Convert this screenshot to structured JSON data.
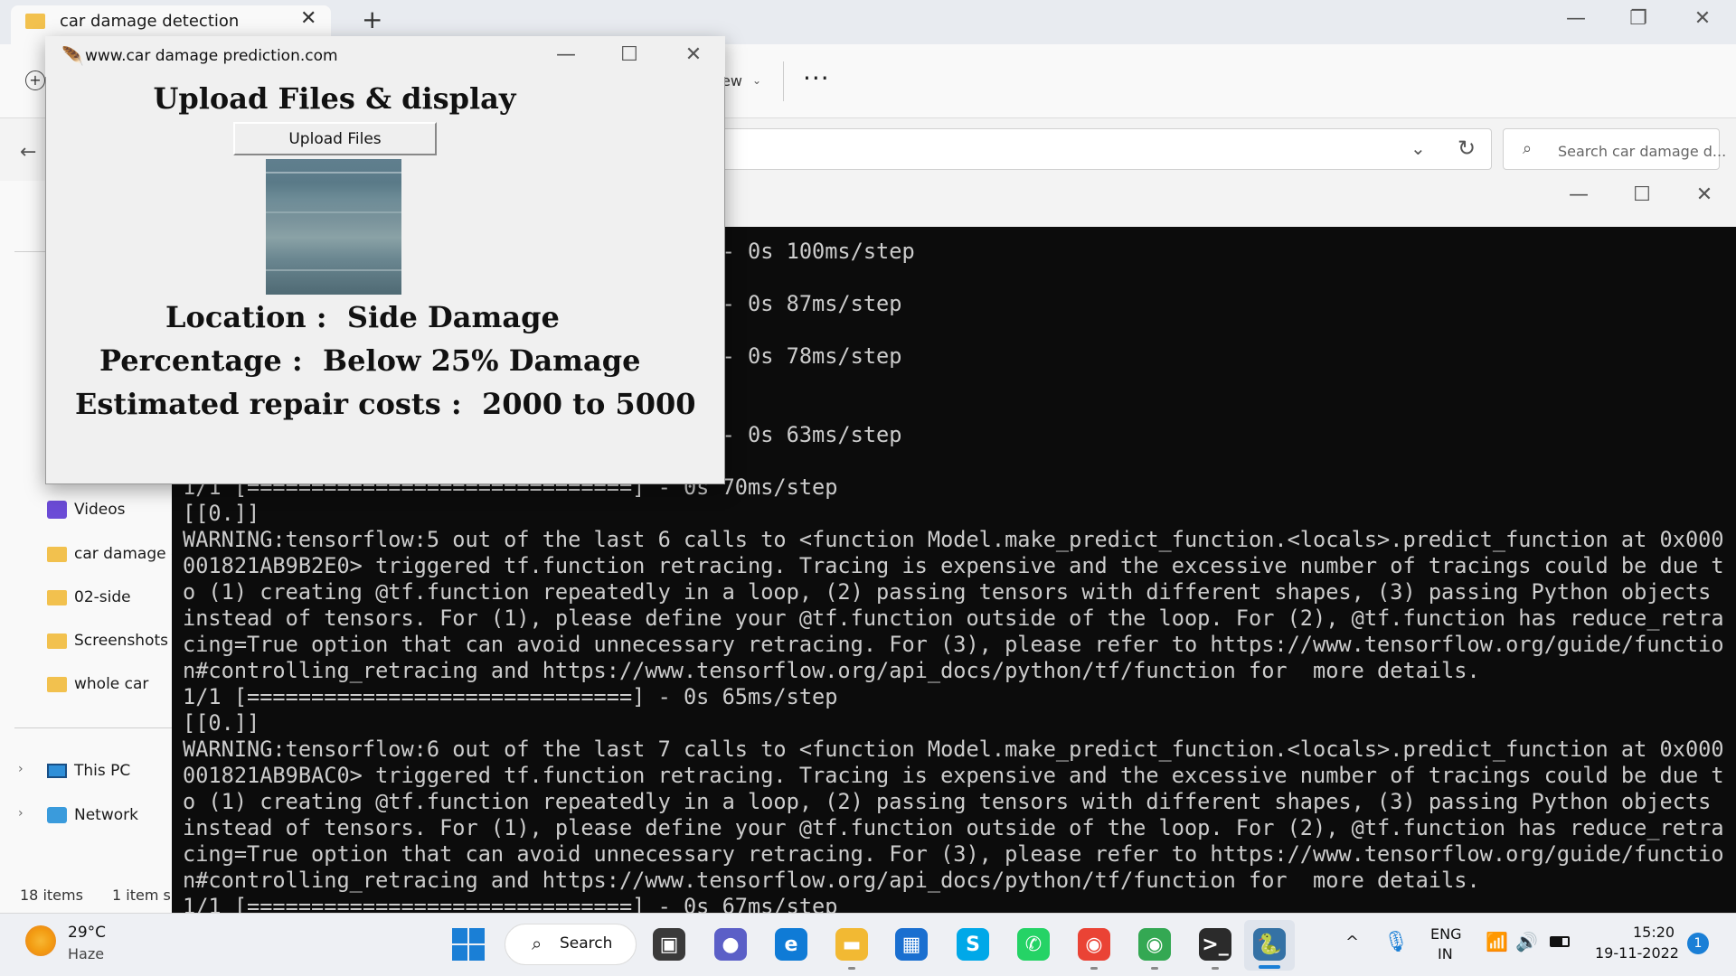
{
  "explorer": {
    "tab_title": "car damage detection",
    "tab_close": "✕",
    "new_tab": "+",
    "minimize": "—",
    "restore": "❐",
    "close": "✕",
    "toolbar_new": "+",
    "view_label": "ew",
    "view_chevron": "⌄",
    "more": "···",
    "back": "←",
    "address_dropdown": "⌄",
    "refresh": "↻",
    "search_placeholder": "Search car damage d...",
    "search_icon": "⌕",
    "nav_items": [
      {
        "label": "Videos",
        "icon": "video-icon"
      },
      {
        "label": "car damage d",
        "icon": "folder-icon"
      },
      {
        "label": "02-side",
        "icon": "folder-icon"
      },
      {
        "label": "Screenshots",
        "icon": "folder-icon"
      },
      {
        "label": "whole car",
        "icon": "folder-icon"
      },
      {
        "label": "This PC",
        "icon": "pc-icon"
      },
      {
        "label": "Network",
        "icon": "network-icon"
      }
    ],
    "nav_chevron": "›",
    "status_items": "18 items",
    "status_selected": "1 item s"
  },
  "console": {
    "minimize": "—",
    "restore": "☐",
    "close": "✕",
    "lines": [
      "                                ========] - 0s 100ms/step",
      "",
      "                                ========] - 0s 87ms/step",
      "",
      "                                ========] - 0s 78ms/step",
      "",
      "",
      "                                ========] - 0s 63ms/step",
      "",
      "1/1 [==============================] - 0s 70ms/step",
      "[[0.]]",
      "WARNING:tensorflow:5 out of the last 6 calls to <function Model.make_predict_function.<locals>.predict_function at 0x000",
      "001821AB9B2E0> triggered tf.function retracing. Tracing is expensive and the excessive number of tracings could be due t",
      "o (1) creating @tf.function repeatedly in a loop, (2) passing tensors with different shapes, (3) passing Python objects",
      "instead of tensors. For (1), please define your @tf.function outside of the loop. For (2), @tf.function has reduce_retra",
      "cing=True option that can avoid unnecessary retracing. For (3), please refer to https://www.tensorflow.org/guide/functio",
      "n#controlling_retracing and https://www.tensorflow.org/api_docs/python/tf/function for  more details.",
      "1/1 [==============================] - 0s 65ms/step",
      "[[0.]]",
      "WARNING:tensorflow:6 out of the last 7 calls to <function Model.make_predict_function.<locals>.predict_function at 0x000",
      "001821AB9BAC0> triggered tf.function retracing. Tracing is expensive and the excessive number of tracings could be due t",
      "o (1) creating @tf.function repeatedly in a loop, (2) passing tensors with different shapes, (3) passing Python objects",
      "instead of tensors. For (1), please define your @tf.function outside of the loop. For (2), @tf.function has reduce_retra",
      "cing=True option that can avoid unnecessary retracing. For (3), please refer to https://www.tensorflow.org/guide/functio",
      "n#controlling_retracing and https://www.tensorflow.org/api_docs/python/tf/function for  more details.",
      "1/1 [==============================] - 0s 67ms/step"
    ]
  },
  "tk_app": {
    "window_title": "www.car damage prediction.com",
    "feather": "🪶",
    "minimize": "—",
    "restore": "☐",
    "close": "✕",
    "heading": "Upload Files & display",
    "upload_button": "Upload Files",
    "location": "Location :  Side Damage",
    "percentage": "Percentage :  Below 25% Damage",
    "repair": "Estimated repair costs :  2000 to 5000"
  },
  "taskbar": {
    "temperature": "29°C",
    "weather": "Haze",
    "search_label": "Search",
    "search_icon": "⌕",
    "apps": [
      {
        "name": "task-view",
        "glyph": "▣",
        "color": "#3a3a3a"
      },
      {
        "name": "teams",
        "glyph": "●",
        "color": "#5b5fc7"
      },
      {
        "name": "edge",
        "glyph": "e",
        "color": "#0f7bd6"
      },
      {
        "name": "file-explorer",
        "glyph": "▬",
        "color": "#f2b933"
      },
      {
        "name": "microsoft-store",
        "glyph": "▦",
        "color": "#1a6fd0"
      },
      {
        "name": "skype",
        "glyph": "S",
        "color": "#00a8e8"
      },
      {
        "name": "whatsapp",
        "glyph": "✆",
        "color": "#25d366"
      },
      {
        "name": "chrome-profile",
        "glyph": "◉",
        "color": "#ea4335"
      },
      {
        "name": "chrome",
        "glyph": "◉",
        "color": "#34a853"
      },
      {
        "name": "terminal",
        "glyph": ">_",
        "color": "#2b2b2b"
      },
      {
        "name": "python",
        "glyph": "🐍",
        "color": "#3572a5"
      }
    ],
    "tray_chevron": "^",
    "mic": "🎙",
    "lang_line1": "ENG",
    "lang_line2": "IN",
    "wifi": "📶",
    "volume": "🔊",
    "time": "15:20",
    "date": "19-11-2022",
    "notification_count": "1"
  }
}
